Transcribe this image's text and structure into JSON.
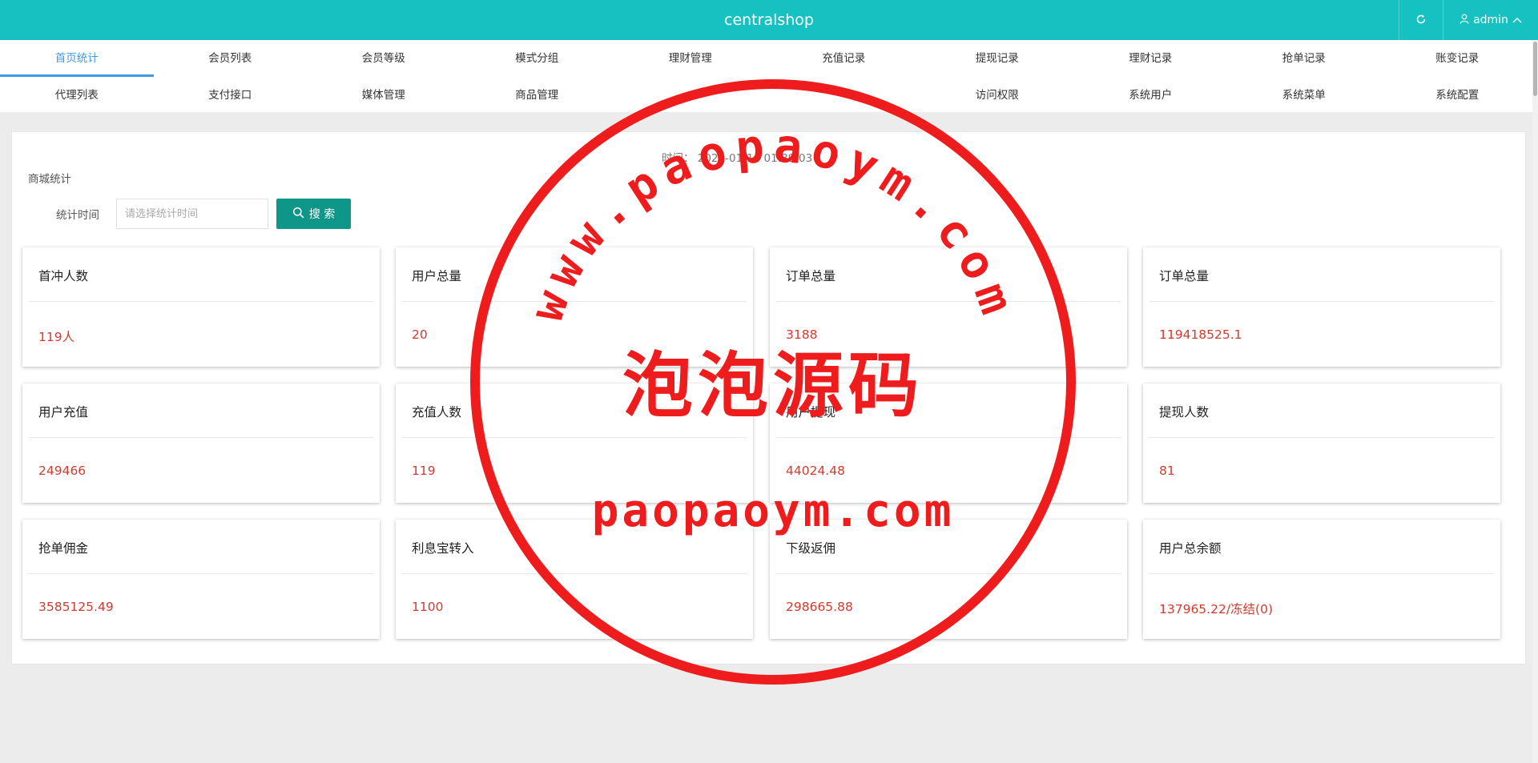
{
  "header": {
    "brand": "centralshop",
    "user": "admin",
    "refresh_icon": "refresh-icon",
    "user_icon": "user-icon",
    "caret_icon": "chevron-up-icon",
    "bg_color": "#16c1c1"
  },
  "nav": {
    "row1": [
      "首页统计",
      "会员列表",
      "会员等级",
      "模式分组",
      "理财管理",
      "充值记录",
      "提现记录",
      "理财记录",
      "抢单记录",
      "账变记录"
    ],
    "row2": [
      "代理列表",
      "支付接口",
      "媒体管理",
      "商品管理",
      "",
      "",
      "访问权限",
      "系统用户",
      "系统菜单",
      "系统配置"
    ],
    "active": "首页统计",
    "active_color": "#3f99e0"
  },
  "panel": {
    "time_label": "时间：",
    "time_value": "2025-01-14 01:39:03",
    "title": "商城统计",
    "filter_label": "统计时间",
    "filter_placeholder": "请选择统计时间",
    "search_label": "搜 索",
    "search_icon": "search-icon",
    "button_color": "#0e9688"
  },
  "cards": [
    {
      "title": "首冲人数",
      "value": "119人"
    },
    {
      "title": "用户总量",
      "value": "20"
    },
    {
      "title": "订单总量",
      "value": "3188"
    },
    {
      "title": "订单总量",
      "value": "119418525.1"
    },
    {
      "title": "用户充值",
      "value": "249466"
    },
    {
      "title": "充值人数",
      "value": "119"
    },
    {
      "title": "用户提现",
      "value": "44024.48"
    },
    {
      "title": "提现人数",
      "value": "81"
    },
    {
      "title": "抢单佣金",
      "value": "3585125.49"
    },
    {
      "title": "利息宝转入",
      "value": "1100"
    },
    {
      "title": "下级返佣",
      "value": "298665.88"
    },
    {
      "title": "用户总余额",
      "value": "137965.22/冻结(0)"
    }
  ],
  "value_color": "#d23b2f",
  "watermark": {
    "arc_text": "www.paopaoym.com",
    "center_text": "泡泡源码",
    "bottom_text": "paopaoym.com",
    "color": "#ee1c1c"
  }
}
